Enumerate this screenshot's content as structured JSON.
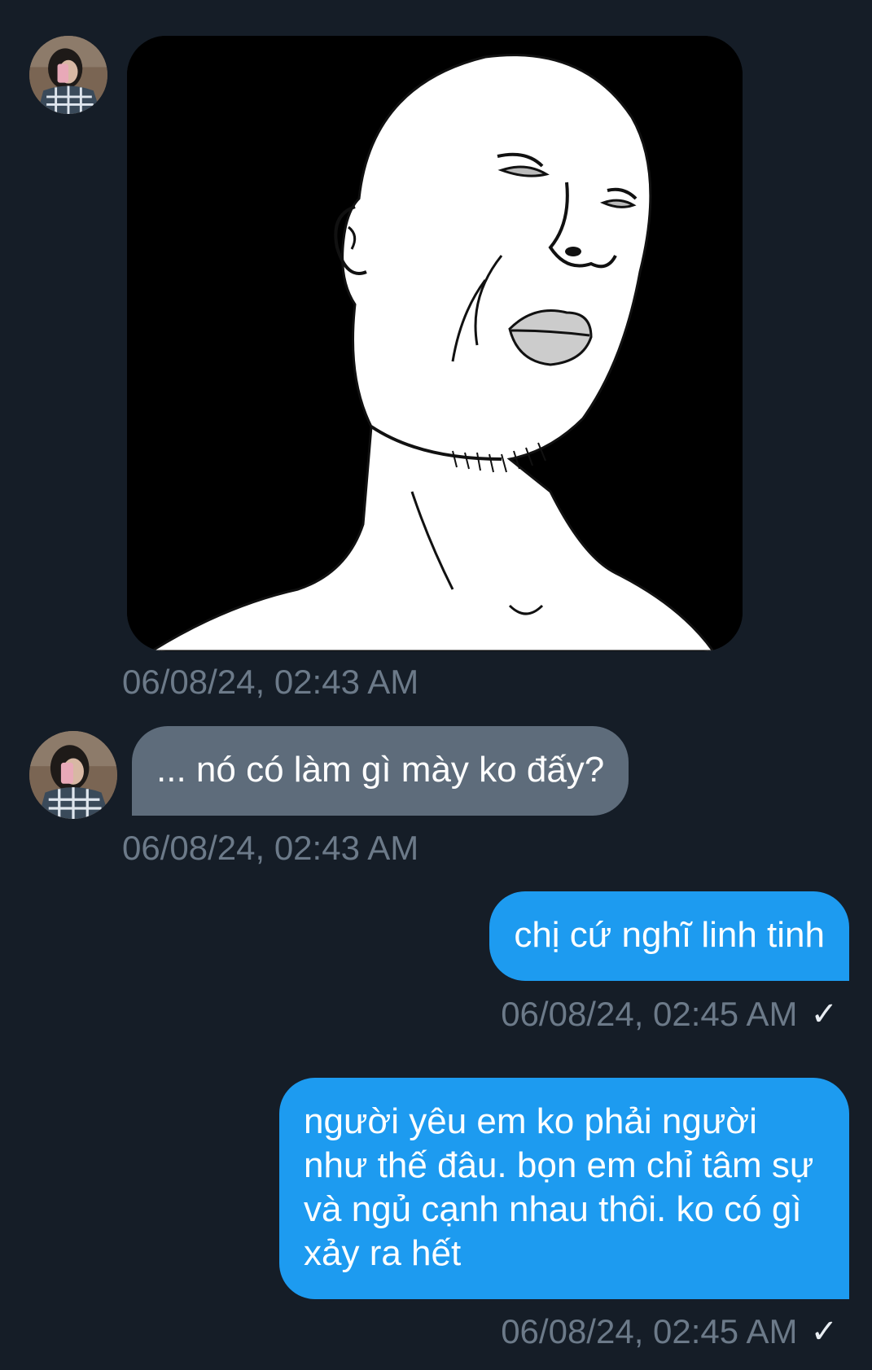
{
  "conversation": {
    "messages": [
      {
        "sender": "incoming",
        "type": "image",
        "image_desc_icon": "meme-face-drawing",
        "time": "06/08/24, 02:43 AM"
      },
      {
        "sender": "incoming",
        "type": "text",
        "text": "... nó có làm gì mày ko đấy?",
        "time": "06/08/24, 02:43 AM"
      },
      {
        "sender": "outgoing",
        "type": "text",
        "text": "chị cứ nghĩ linh tinh",
        "time": "06/08/24, 02:45 AM",
        "status_icon": "checkmark-icon"
      },
      {
        "sender": "outgoing",
        "type": "text",
        "text": "người yêu em ko phải người như thế đâu. bọn em chỉ tâm sự và ngủ cạnh nhau thôi. ko có gì xảy ra hết",
        "time": "06/08/24, 02:45 AM",
        "status_icon": "checkmark-icon"
      }
    ],
    "check_glyph": "✓"
  },
  "colors": {
    "background": "#151d27",
    "incoming_bubble": "#5e6c7b",
    "outgoing_bubble": "#1d9bf0",
    "timestamp": "#6c7a89"
  }
}
